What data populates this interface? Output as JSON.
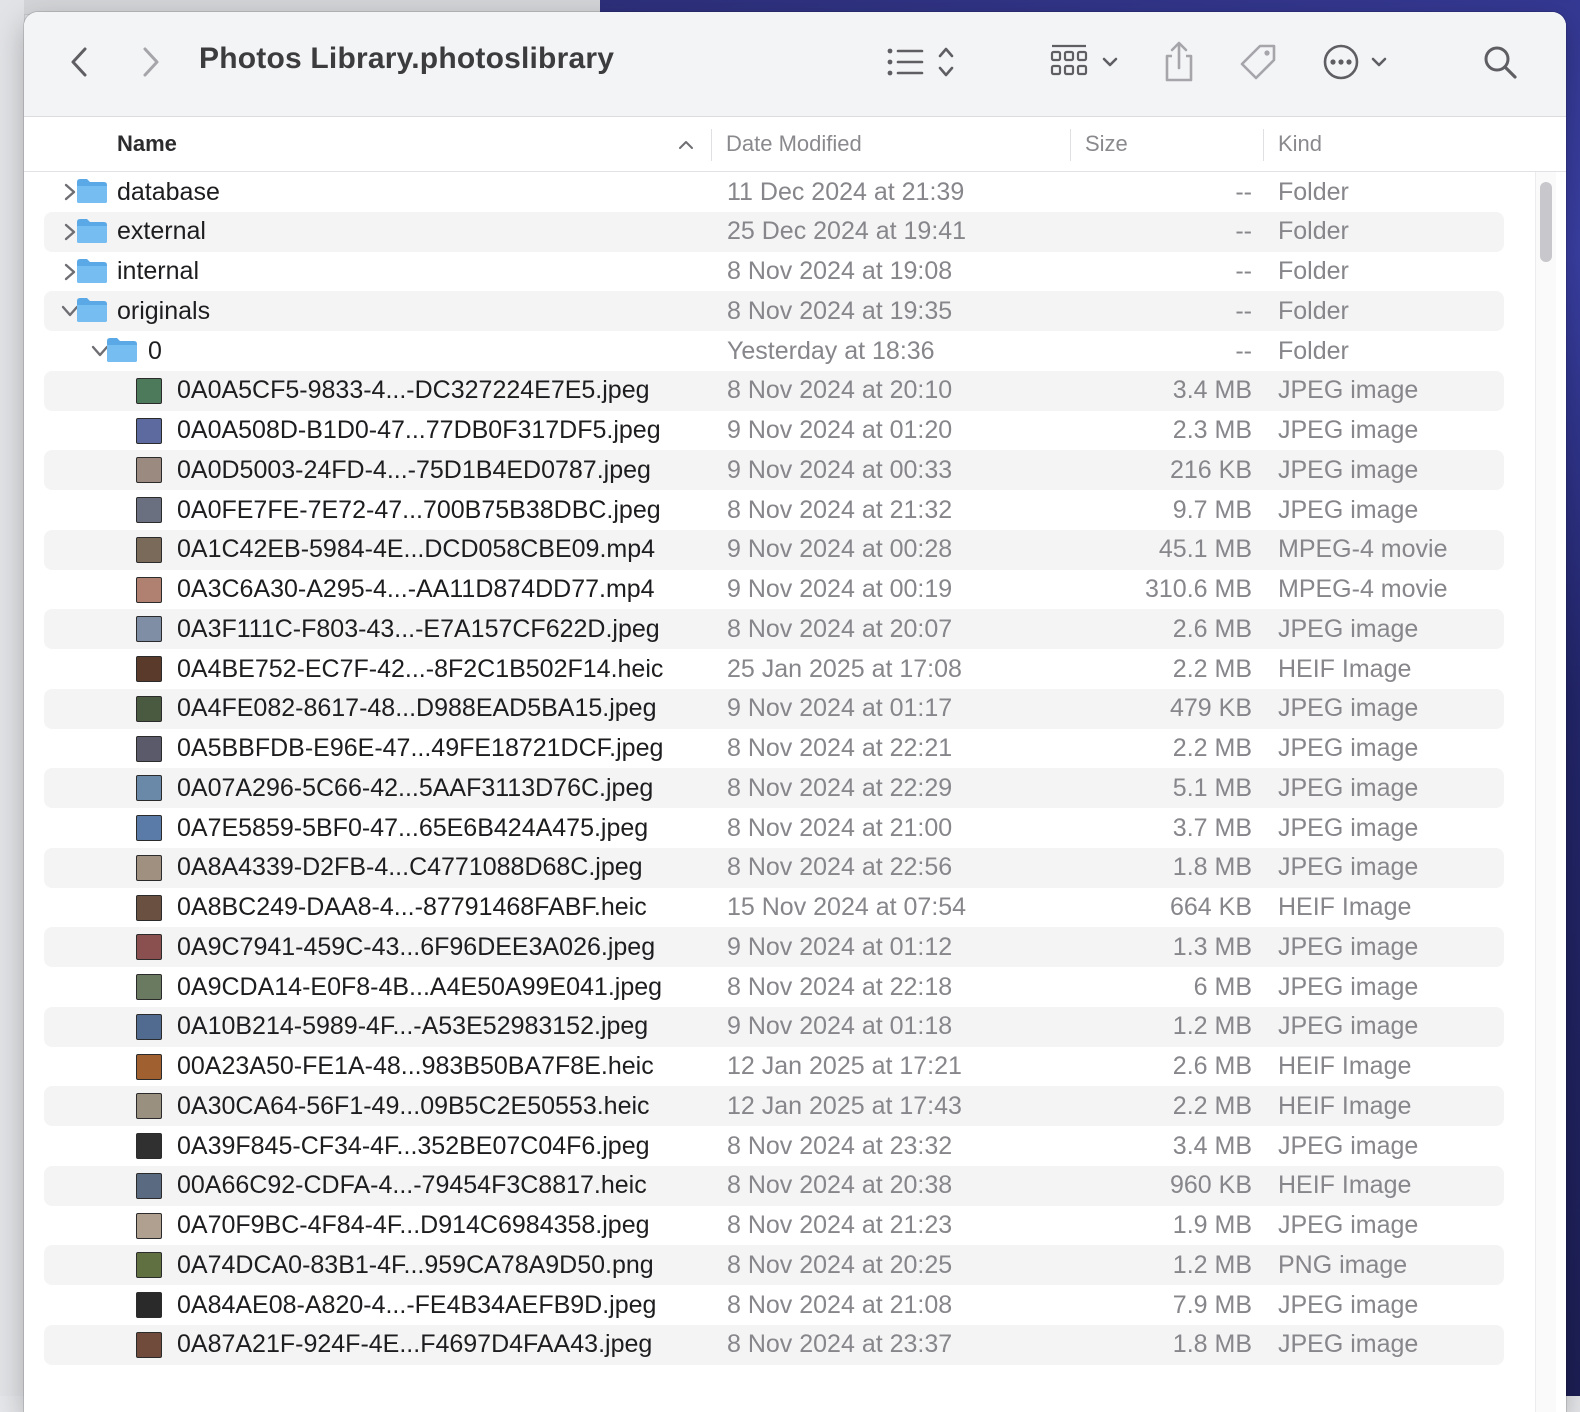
{
  "window": {
    "title": "Photos Library.photoslibrary"
  },
  "toolbar": {
    "back": "chevron-left-icon",
    "forward": "chevron-right-icon",
    "view_list": "list-view-icon",
    "group": "grid-group-icon",
    "share": "share-icon",
    "tags": "tag-icon",
    "more": "ellipsis-circle-icon",
    "search": "search-icon"
  },
  "columns": {
    "name": "Name",
    "date": "Date Modified",
    "size": "Size",
    "kind": "Kind"
  },
  "rows": [
    {
      "name": "database",
      "date": "11 Dec 2024 at 21:39",
      "size": "--",
      "kind": "Folder",
      "type": "folder",
      "level": 0,
      "expanded": false
    },
    {
      "name": "external",
      "date": "25 Dec 2024 at 19:41",
      "size": "--",
      "kind": "Folder",
      "type": "folder",
      "level": 0,
      "expanded": false
    },
    {
      "name": "internal",
      "date": "8 Nov 2024 at 19:08",
      "size": "--",
      "kind": "Folder",
      "type": "folder",
      "level": 0,
      "expanded": false
    },
    {
      "name": "originals",
      "date": "8 Nov 2024 at 19:35",
      "size": "--",
      "kind": "Folder",
      "type": "folder",
      "level": 0,
      "expanded": true
    },
    {
      "name": "0",
      "date": "Yesterday at 18:36",
      "size": "--",
      "kind": "Folder",
      "type": "folder",
      "level": 1,
      "expanded": true
    },
    {
      "name": "0A0A5CF5-9833-4...-DC327224E7E5.jpeg",
      "date": "8 Nov 2024 at 20:10",
      "size": "3.4 MB",
      "kind": "JPEG image",
      "type": "file",
      "level": 2,
      "thumb": "#4d7a5a"
    },
    {
      "name": "0A0A508D-B1D0-47...77DB0F317DF5.jpeg",
      "date": "9 Nov 2024 at 01:20",
      "size": "2.3 MB",
      "kind": "JPEG image",
      "type": "file",
      "level": 2,
      "thumb": "#5c6aa0"
    },
    {
      "name": "0A0D5003-24FD-4...-75D1B4ED0787.jpeg",
      "date": "9 Nov 2024 at 00:33",
      "size": "216 KB",
      "kind": "JPEG image",
      "type": "file",
      "level": 2,
      "thumb": "#9a8a80"
    },
    {
      "name": "0A0FE7FE-7E72-47...700B75B38DBC.jpeg",
      "date": "8 Nov 2024 at 21:32",
      "size": "9.7 MB",
      "kind": "JPEG image",
      "type": "file",
      "level": 2,
      "thumb": "#6a7080"
    },
    {
      "name": "0A1C42EB-5984-4E...DCD058CBE09.mp4",
      "date": "9 Nov 2024 at 00:28",
      "size": "45.1 MB",
      "kind": "MPEG-4 movie",
      "type": "file",
      "level": 2,
      "thumb": "#7a6a5a"
    },
    {
      "name": "0A3C6A30-A295-4...-AA11D874DD77.mp4",
      "date": "9 Nov 2024 at 00:19",
      "size": "310.6 MB",
      "kind": "MPEG-4 movie",
      "type": "file",
      "level": 2,
      "thumb": "#b08070"
    },
    {
      "name": "0A3F111C-F803-43...-E7A157CF622D.jpeg",
      "date": "8 Nov 2024 at 20:07",
      "size": "2.6 MB",
      "kind": "JPEG image",
      "type": "file",
      "level": 2,
      "thumb": "#7f8da5"
    },
    {
      "name": "0A4BE752-EC7F-42...-8F2C1B502F14.heic",
      "date": "25 Jan 2025 at 17:08",
      "size": "2.2 MB",
      "kind": "HEIF Image",
      "type": "file",
      "level": 2,
      "thumb": "#5a3a2a"
    },
    {
      "name": "0A4FE082-8617-48...D988EAD5BA15.jpeg",
      "date": "9 Nov 2024 at 01:17",
      "size": "479 KB",
      "kind": "JPEG image",
      "type": "file",
      "level": 2,
      "thumb": "#4a5a40"
    },
    {
      "name": "0A5BBFDB-E96E-47...49FE18721DCF.jpeg",
      "date": "8 Nov 2024 at 22:21",
      "size": "2.2 MB",
      "kind": "JPEG image",
      "type": "file",
      "level": 2,
      "thumb": "#5a5a6a"
    },
    {
      "name": "0A07A296-5C66-42...5AAF3113D76C.jpeg",
      "date": "8 Nov 2024 at 22:29",
      "size": "5.1 MB",
      "kind": "JPEG image",
      "type": "file",
      "level": 2,
      "thumb": "#6a88a8"
    },
    {
      "name": "0A7E5859-5BF0-47...65E6B424A475.jpeg",
      "date": "8 Nov 2024 at 21:00",
      "size": "3.7 MB",
      "kind": "JPEG image",
      "type": "file",
      "level": 2,
      "thumb": "#5a7aa8"
    },
    {
      "name": "0A8A4339-D2FB-4...C4771088D68C.jpeg",
      "date": "8 Nov 2024 at 22:56",
      "size": "1.8 MB",
      "kind": "JPEG image",
      "type": "file",
      "level": 2,
      "thumb": "#a09080"
    },
    {
      "name": "0A8BC249-DAA8-4...-87791468FABF.heic",
      "date": "15 Nov 2024 at 07:54",
      "size": "664 KB",
      "kind": "HEIF Image",
      "type": "file",
      "level": 2,
      "thumb": "#6a5040"
    },
    {
      "name": "0A9C7941-459C-43...6F96DEE3A026.jpeg",
      "date": "9 Nov 2024 at 01:12",
      "size": "1.3 MB",
      "kind": "JPEG image",
      "type": "file",
      "level": 2,
      "thumb": "#8a5050"
    },
    {
      "name": "0A9CDA14-E0F8-4B...A4E50A99E041.jpeg",
      "date": "8 Nov 2024 at 22:18",
      "size": "6 MB",
      "kind": "JPEG image",
      "type": "file",
      "level": 2,
      "thumb": "#6a7a60"
    },
    {
      "name": "0A10B214-5989-4F...-A53E52983152.jpeg",
      "date": "9 Nov 2024 at 01:18",
      "size": "1.2 MB",
      "kind": "JPEG image",
      "type": "file",
      "level": 2,
      "thumb": "#506a90"
    },
    {
      "name": "00A23A50-FE1A-48...983B50BA7F8E.heic",
      "date": "12 Jan 2025 at 17:21",
      "size": "2.6 MB",
      "kind": "HEIF Image",
      "type": "file",
      "level": 2,
      "thumb": "#a06030"
    },
    {
      "name": "0A30CA64-56F1-49...09B5C2E50553.heic",
      "date": "12 Jan 2025 at 17:43",
      "size": "2.2 MB",
      "kind": "HEIF Image",
      "type": "file",
      "level": 2,
      "thumb": "#9a9080"
    },
    {
      "name": "0A39F845-CF34-4F...352BE07C04F6.jpeg",
      "date": "8 Nov 2024 at 23:32",
      "size": "3.4 MB",
      "kind": "JPEG image",
      "type": "file",
      "level": 2,
      "thumb": "#303030"
    },
    {
      "name": "00A66C92-CDFA-4...-79454F3C8817.heic",
      "date": "8 Nov 2024 at 20:38",
      "size": "960 KB",
      "kind": "HEIF Image",
      "type": "file",
      "level": 2,
      "thumb": "#5a6a80"
    },
    {
      "name": "0A70F9BC-4F84-4F...D914C6984358.jpeg",
      "date": "8 Nov 2024 at 21:23",
      "size": "1.9 MB",
      "kind": "JPEG image",
      "type": "file",
      "level": 2,
      "thumb": "#b0a090"
    },
    {
      "name": "0A74DCA0-83B1-4F...959CA78A9D50.png",
      "date": "8 Nov 2024 at 20:25",
      "size": "1.2 MB",
      "kind": "PNG image",
      "type": "file",
      "level": 2,
      "thumb": "#607040"
    },
    {
      "name": "0A84AE08-A820-4...-FE4B34AEFB9D.jpeg",
      "date": "8 Nov 2024 at 21:08",
      "size": "7.9 MB",
      "kind": "JPEG image",
      "type": "file",
      "level": 2,
      "thumb": "#2a2a2a"
    },
    {
      "name": "0A87A21F-924F-4E...F4697D4FAA43.jpeg",
      "date": "8 Nov 2024 at 23:37",
      "size": "1.8 MB",
      "kind": "JPEG image",
      "type": "file",
      "level": 2,
      "thumb": "#704a3a"
    }
  ]
}
